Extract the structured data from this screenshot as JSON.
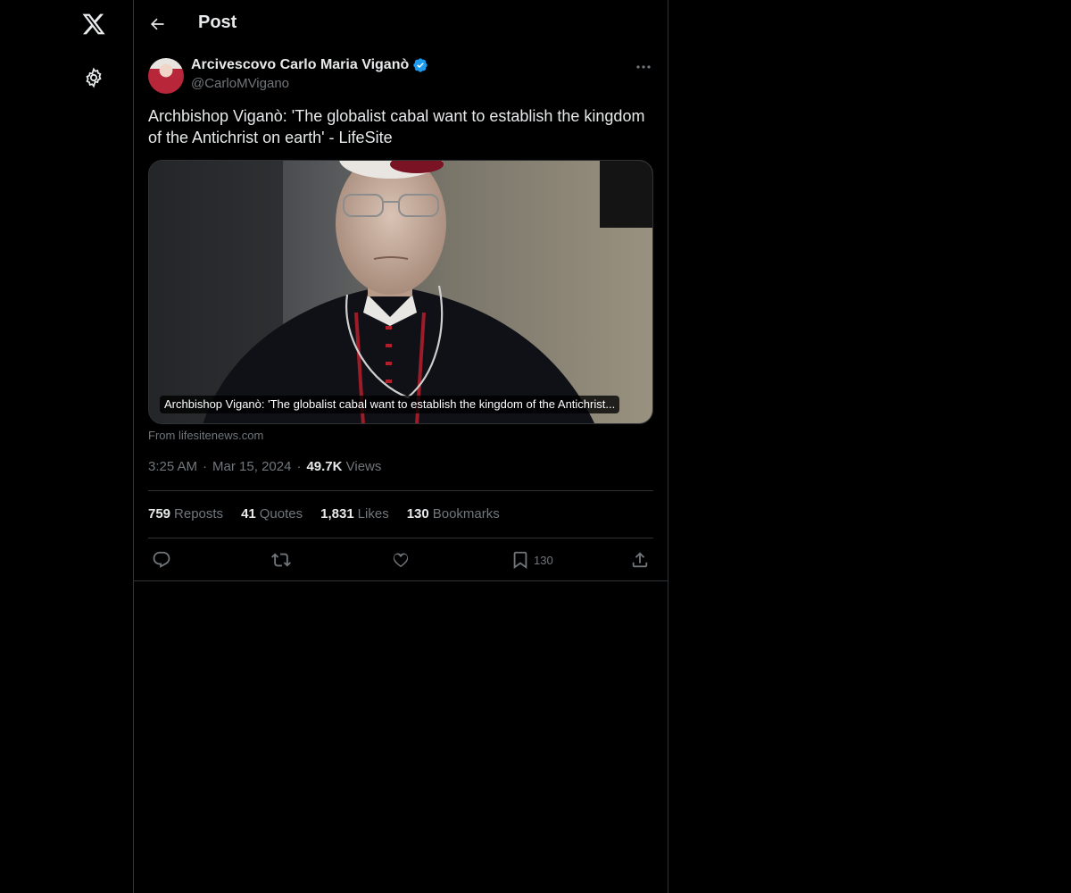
{
  "nav": {
    "logo_icon": "x-logo-icon",
    "settings_icon": "gear-icon"
  },
  "header": {
    "title": "Post",
    "back_icon": "arrow-left-icon"
  },
  "post": {
    "author_name": "Arcivescovo Carlo Maria Viganò",
    "author_handle": "@CarloMVigano",
    "verified": true,
    "text": "Archbishop Viganò: 'The globalist cabal want to establish the kingdom of the Antichrist on earth' - LifeSite",
    "card": {
      "caption": "Archbishop Viganò: 'The globalist cabal want to establish the kingdom of the Antichrist...",
      "source": "From lifesitenews.com"
    },
    "time": "3:25 AM",
    "date": "Mar 15, 2024",
    "views_count": "49.7K",
    "views_label": "Views",
    "stats": {
      "reposts_count": "759",
      "reposts_label": "Reposts",
      "quotes_count": "41",
      "quotes_label": "Quotes",
      "likes_count": "1,831",
      "likes_label": "Likes",
      "bookmarks_count": "130",
      "bookmarks_label": "Bookmarks"
    },
    "actions": {
      "bookmark_count": "130"
    }
  },
  "colors": {
    "background": "#000000",
    "text_primary": "#e7e9ea",
    "text_secondary": "#71767b",
    "border": "#2f3336",
    "verified_blue": "#1d9bf0"
  }
}
